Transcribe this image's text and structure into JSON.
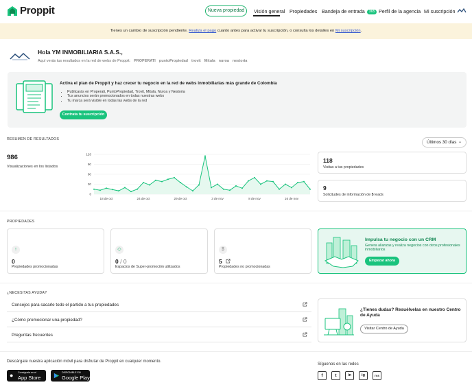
{
  "app": {
    "name": "Proppit"
  },
  "nav": {
    "new_property": "Nueva propiedad",
    "overview": "Visión general",
    "properties": "Propiedades",
    "inbox": "Bandeja de entrada",
    "inbox_badge": "365",
    "agency_profile": "Perfil de la agencia",
    "subscription": "Mi suscripción"
  },
  "banner": {
    "text_before": "Tienes un cambio de suscripción pendiente. ",
    "link1": "Realiza el pago",
    "text_mid": " cuanto antes para activar tu suscripción, o consulta los detalles en ",
    "link2": "Mi suscripción",
    "text_after": "."
  },
  "greeting": {
    "hello": "Hola YM INMOBILIARIA S.A.S.,",
    "subtitle": "Aquí verás tus resultados en la red de webs de Proppit:",
    "brands": [
      "PROPERATI",
      "puntoPropiedad",
      "trovit",
      "Mitula",
      "nuroa",
      "nestoria"
    ]
  },
  "plan": {
    "title": "Activa el plan de Proppit y haz crecer tu negocio en la red de webs inmobiliarias más grande de Colombia",
    "bullets": [
      "Publicarás en Properati, PuntoPropiedad, Trovit, Mitula, Nuroa y Nestoria",
      "Tus anuncios serán promocionados en todas nuestras webs",
      "Tu marca será visible en todas las webs de la red"
    ],
    "cta": "Contrata tu suscripción"
  },
  "results": {
    "section_label": "RESUMEN DE RESULTADOS",
    "period": "Últimos 30 días",
    "views_value": "986",
    "views_label": "Visualizaciones en los listados",
    "visits_value": "118",
    "visits_label": "Visitas a tus propiedades",
    "leads_value": "9",
    "leads_label_prefix": "Solicitudes de información de ",
    "leads_count": "5",
    "leads_label_suffix": " leads"
  },
  "chart_data": {
    "type": "line",
    "yticks": [
      0,
      30,
      60,
      90,
      120
    ],
    "ylim": [
      0,
      120
    ],
    "xticks": [
      "18 de oct",
      "24 de oct",
      "29 de oct",
      "3 de nov",
      "8 de nov",
      "16 de nov"
    ],
    "xtick_index": [
      2,
      8,
      14,
      20,
      26,
      32
    ],
    "values": [
      15,
      12,
      18,
      14,
      10,
      20,
      8,
      15,
      35,
      28,
      42,
      38,
      45,
      50,
      35,
      22,
      10,
      28,
      115,
      20,
      30,
      15,
      12,
      25,
      18,
      40,
      50,
      30,
      40,
      38,
      15,
      30,
      20,
      35,
      38,
      15
    ],
    "color": "#19c37d"
  },
  "properties": {
    "section_label": "PROPIEDADES",
    "cards": [
      {
        "value": "0",
        "sub": "",
        "label": "Propiedades promocionadas",
        "icon": "arrow-up-icon"
      },
      {
        "value": "0",
        "sub": " / 0",
        "label": "Espacios de Super-promoción utilizados",
        "icon": "diamond-icon"
      },
      {
        "value": "5",
        "sub": "",
        "label": "Propiedades no promocionadas",
        "icon": "dollar-icon"
      }
    ],
    "crm": {
      "title": "Impulsa tu negocio con un CRM",
      "text": "Genera alianzas y realiza negocios con otros profesionales inmobiliarios",
      "cta": "Empezar ahora"
    }
  },
  "help": {
    "section_label": "¿NECESITAS AYUDA?",
    "links": [
      "Consejos para sacarle todo el partido a tus propiedades",
      "¿Cómo promocionar una propiedad?",
      "Preguntas frecuentes"
    ],
    "center_title": "¿Tienes dudas? Resuélvelas en nuestro Centro de Ayuda",
    "center_cta": "Visitar Centro de Ayuda"
  },
  "footer": {
    "app_text": "Descárgate nuestra aplicación móvil para disfrutar de Proppit en cualquier momento.",
    "appstore_small": "Consíguela en el",
    "appstore_big": "App Store",
    "googleplay_small": "DISPONIBLE EN",
    "googleplay_big": "Google Play",
    "follow": "Síguenos en las redes",
    "socials": [
      "f",
      "t",
      "in",
      "ig",
      "rss"
    ]
  }
}
